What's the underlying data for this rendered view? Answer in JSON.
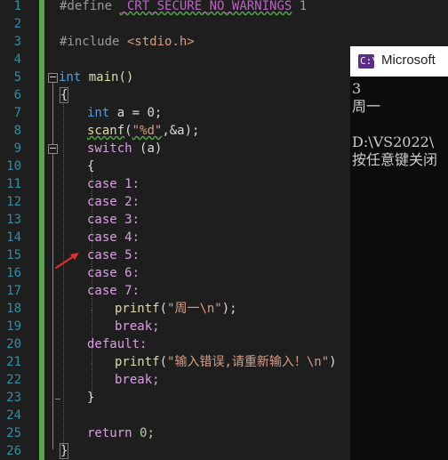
{
  "editor": {
    "line_numbers": [
      "1",
      "2",
      "3",
      "4",
      "5",
      "6",
      "7",
      "8",
      "9",
      "10",
      "11",
      "12",
      "13",
      "14",
      "15",
      "16",
      "17",
      "18",
      "19",
      "20",
      "21",
      "22",
      "23",
      "24",
      "25",
      "26"
    ],
    "line1": {
      "directive": "#define",
      "macro": "_CRT_SECURE_NO_WARNINGS",
      "value": "1"
    },
    "line3": {
      "directive": "#include",
      "header": "<stdio.h>"
    },
    "line5": {
      "type": "int",
      "name": "main()"
    },
    "line6": "{",
    "line7": {
      "type": "int",
      "rest": "a = 0;"
    },
    "line8": {
      "fn": "scanf",
      "open": "(",
      "fmt": "\"%d\"",
      "rest": ",&a);"
    },
    "line9": {
      "kw": "switch",
      "rest": "(a)"
    },
    "line10": "{",
    "cases": [
      "case 1:",
      "case 2:",
      "case 3:",
      "case 4:",
      "case 5:",
      "case 6:",
      "case 7:"
    ],
    "line18": {
      "fn": "printf",
      "open": "(",
      "str": "\"周一\\n\"",
      "close": ");"
    },
    "line19": "break;",
    "line20": "default:",
    "line21": {
      "fn": "printf",
      "open": "(",
      "str": "\"输入错误,请重新输入！\\n\"",
      "close": ")"
    },
    "line22": "break;",
    "line23": "}",
    "line25": {
      "kw": "return",
      "rest": "0;"
    },
    "line26": "}"
  },
  "console": {
    "title": "Microsoft",
    "lines": [
      "3",
      "周一",
      "",
      "D:\\VS2022\\",
      "按任意键关闭"
    ]
  },
  "colors": {
    "background": "#1e1e1e",
    "line_number": "#2b91af",
    "change_bar": "#57a64a",
    "keyword": "#569cd6",
    "macro": "#bd63c5",
    "string": "#d69d85",
    "arrow": "#e03030"
  }
}
